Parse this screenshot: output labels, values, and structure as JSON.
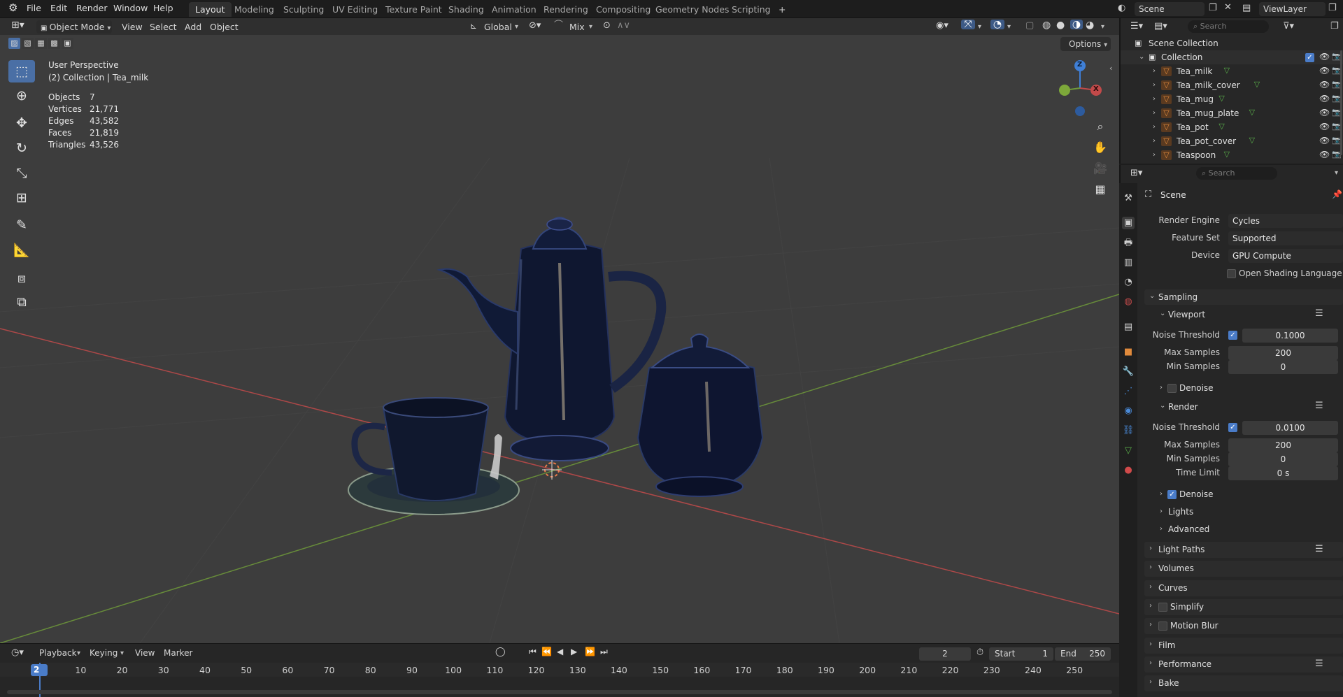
{
  "topbar": {
    "menus": [
      "File",
      "Edit",
      "Render",
      "Window",
      "Help"
    ],
    "workspaces": [
      "Layout",
      "Modeling",
      "Sculpting",
      "UV Editing",
      "Texture Paint",
      "Shading",
      "Animation",
      "Rendering",
      "Compositing",
      "Geometry Nodes",
      "Scripting"
    ],
    "active_workspace": "Layout",
    "add_tab": "+",
    "scene": "Scene",
    "view_layer": "ViewLayer"
  },
  "viewport_header": {
    "mode": "Object Mode",
    "menus": [
      "View",
      "Select",
      "Add",
      "Object"
    ],
    "orientation": "Global",
    "pivot_mix": "Mix",
    "options": "Options"
  },
  "overlay": {
    "view_name": "User Perspective",
    "context": "(2) Collection | Tea_milk",
    "stats": [
      {
        "key": "Objects",
        "value": "7"
      },
      {
        "key": "Vertices",
        "value": "21,771"
      },
      {
        "key": "Edges",
        "value": "43,582"
      },
      {
        "key": "Faces",
        "value": "21,819"
      },
      {
        "key": "Triangles",
        "value": "43,526"
      }
    ]
  },
  "gizmo": {
    "z": "Z",
    "x": "X"
  },
  "timeline": {
    "menus": [
      "Playback",
      "Keying",
      "View",
      "Marker"
    ],
    "current_frame": "2",
    "start_label": "Start",
    "start": "1",
    "end_label": "End",
    "end": "250",
    "ticks": [
      "2",
      "10",
      "20",
      "30",
      "40",
      "50",
      "60",
      "70",
      "80",
      "90",
      "100",
      "110",
      "120",
      "130",
      "140",
      "150",
      "160",
      "170",
      "180",
      "190",
      "200",
      "210",
      "220",
      "230",
      "240",
      "250"
    ]
  },
  "outliner": {
    "search_placeholder": "Search",
    "root": "Scene Collection",
    "collection": "Collection",
    "objects": [
      "Tea_milk",
      "Tea_milk_cover",
      "Tea_mug",
      "Tea_mug_plate",
      "Tea_pot",
      "Tea_pot_cover",
      "Teaspoon"
    ]
  },
  "properties": {
    "search_placeholder": "Search",
    "context": "Scene",
    "render_engine_label": "Render Engine",
    "render_engine": "Cycles",
    "feature_set_label": "Feature Set",
    "feature_set": "Supported",
    "device_label": "Device",
    "device": "GPU Compute",
    "osl_label": "Open Shading Language",
    "sampling": "Sampling",
    "viewport": "Viewport",
    "noise_threshold_label": "Noise Threshold",
    "viewport_noise_threshold": "0.1000",
    "max_samples_label": "Max Samples",
    "viewport_max_samples": "200",
    "min_samples_label": "Min Samples",
    "viewport_min_samples": "0",
    "denoise_label": "Denoise",
    "render": "Render",
    "render_noise_threshold": "0.0100",
    "render_max_samples": "200",
    "render_min_samples": "0",
    "time_limit_label": "Time Limit",
    "time_limit": "0 s",
    "lights": "Lights",
    "advanced": "Advanced",
    "panels": [
      "Light Paths",
      "Volumes",
      "Curves",
      "Simplify",
      "Motion Blur",
      "Film",
      "Performance",
      "Bake"
    ]
  },
  "colors": {
    "accent": "#4a7cc8",
    "x_axis": "#c24a4a",
    "y_axis": "#6f9a3a",
    "z_axis": "#3f7fd6",
    "object_orange": "#e08a3c"
  }
}
